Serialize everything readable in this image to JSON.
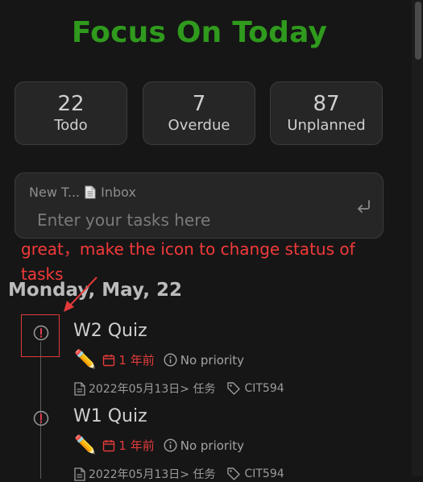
{
  "app": {
    "title": "Focus On Today"
  },
  "stats": [
    {
      "count": "22",
      "label": "Todo"
    },
    {
      "count": "7",
      "label": "Overdue"
    },
    {
      "count": "87",
      "label": "Unplanned"
    }
  ],
  "new_task": {
    "name_truncated": "New T...",
    "project": "Inbox",
    "placeholder": "Enter your tasks here"
  },
  "annotation": {
    "text": "great，make the icon to change status of tasks"
  },
  "day": {
    "heading": "Monday, May, 22"
  },
  "tasks": [
    {
      "title": "W2 Quiz",
      "due": "1 年前",
      "priority": "No priority",
      "path": "2022年05月13日> 任务",
      "tag": "CIT594"
    },
    {
      "title": "W1 Quiz",
      "due": "1 年前",
      "priority": "No priority",
      "path": "2022年05月13日> 任务",
      "tag": "CIT594"
    }
  ],
  "colors": {
    "accent": "#2f9a1d",
    "overdue": "#e33b3b",
    "annotation": "#f23a3a"
  },
  "icons": {
    "status": "alert-circle-icon",
    "edit": "pencil-icon",
    "due": "calendar-icon",
    "priority": "info-icon",
    "path": "document-icon",
    "tag": "tag-icon",
    "submit": "enter-icon"
  }
}
